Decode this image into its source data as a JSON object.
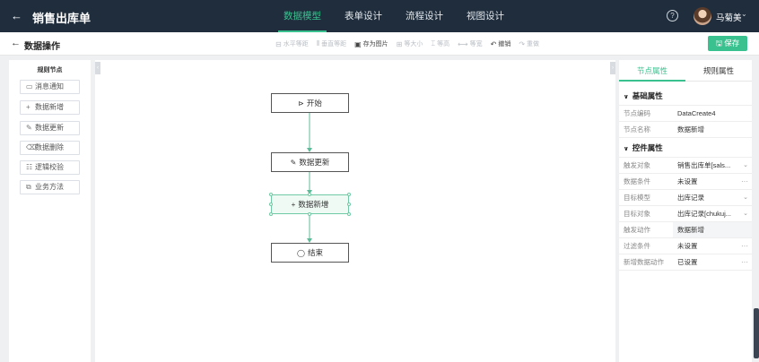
{
  "header": {
    "title": "销售出库单",
    "tabs": [
      {
        "label": "数据模型",
        "active": true
      },
      {
        "label": "表单设计",
        "active": false
      },
      {
        "label": "流程设计",
        "active": false
      },
      {
        "label": "视图设计",
        "active": false
      }
    ],
    "help_icon": "?",
    "user_name": "马菊美"
  },
  "subheader": {
    "title": "数据操作",
    "toolbar": [
      {
        "label": "水平等距",
        "icon": "align-horizontal-icon",
        "enabled": false
      },
      {
        "label": "垂直等距",
        "icon": "align-vertical-icon",
        "enabled": false
      },
      {
        "label": "存为图片",
        "icon": "image-icon",
        "enabled": true
      },
      {
        "label": "等大小",
        "icon": "same-size-icon",
        "enabled": false
      },
      {
        "label": "等高",
        "icon": "same-height-icon",
        "enabled": false
      },
      {
        "label": "等宽",
        "icon": "same-width-icon",
        "enabled": false
      },
      {
        "label": "撤销",
        "icon": "undo-icon",
        "enabled": true
      },
      {
        "label": "重做",
        "icon": "redo-icon",
        "enabled": false
      }
    ],
    "save_label": "保存"
  },
  "left_panel": {
    "title": "规则节点",
    "items": [
      {
        "label": "消息通知",
        "icon": "message-icon",
        "glyph": "▭"
      },
      {
        "label": "数据新增",
        "icon": "plus-icon",
        "glyph": "+"
      },
      {
        "label": "数据更新",
        "icon": "edit-icon",
        "glyph": "✎"
      },
      {
        "label": "数据删除",
        "icon": "trash-icon",
        "glyph": "🗑"
      },
      {
        "label": "逻辑校验",
        "icon": "checklist-icon",
        "glyph": "☷"
      },
      {
        "label": "业务方法",
        "icon": "method-icon",
        "glyph": "⧉"
      }
    ]
  },
  "flow": {
    "nodes": [
      {
        "id": "start",
        "label": "开始",
        "icon": "play-circle-icon",
        "glyph": "▷"
      },
      {
        "id": "update",
        "label": "数据更新",
        "icon": "edit-icon",
        "glyph": "✎"
      },
      {
        "id": "create",
        "label": "数据新增",
        "icon": "plus-icon",
        "glyph": "+",
        "selected": true
      },
      {
        "id": "end",
        "label": "结束",
        "icon": "stop-circle-icon",
        "glyph": "◯"
      }
    ]
  },
  "right_panel": {
    "tabs": [
      {
        "label": "节点属性",
        "active": true
      },
      {
        "label": "规则属性",
        "active": false
      }
    ],
    "basic_section": "基础属性",
    "basic_props": [
      {
        "label": "节点编码",
        "value": "DataCreate4"
      },
      {
        "label": "节点名称",
        "value": "数据新增"
      }
    ],
    "control_section": "控件属性",
    "control_props": [
      {
        "label": "触发对象",
        "value": "销售出库单[sals...",
        "suffix": "⌄"
      },
      {
        "label": "数据条件",
        "value": "未设置",
        "suffix": "···"
      },
      {
        "label": "目标模型",
        "value": "出库记录",
        "suffix": "⌄"
      },
      {
        "label": "目标对象",
        "value": "出库记录[chukuj...",
        "suffix": "⌄"
      },
      {
        "label": "触发动作",
        "value": "数据新增",
        "suffix": "",
        "readonly": true
      },
      {
        "label": "过滤条件",
        "value": "未设置",
        "suffix": "···"
      },
      {
        "label": "新增数据动作",
        "value": "已设置",
        "suffix": "···"
      }
    ]
  },
  "colors": {
    "accent": "#39c28f",
    "header_bg": "#1f2d3d",
    "edge": "#5dbb98"
  }
}
